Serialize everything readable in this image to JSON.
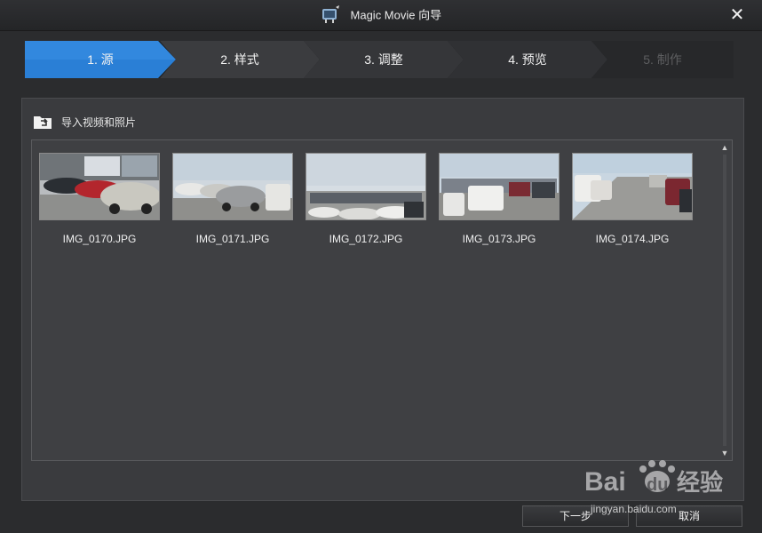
{
  "window": {
    "title": "Magic Movie 向导",
    "icons": {
      "app": "magic-movie-icon",
      "close": "close-icon"
    },
    "close_glyph": "✕"
  },
  "steps": [
    {
      "label": "1. 源",
      "state": "active"
    },
    {
      "label": "2. 样式",
      "state": "normal"
    },
    {
      "label": "3. 调整",
      "state": "normal"
    },
    {
      "label": "4. 预览",
      "state": "normal"
    },
    {
      "label": "5. 制作",
      "state": "disabled"
    }
  ],
  "source": {
    "import_label": "导入视频和照片",
    "import_icon": "folder-import-icon",
    "items": [
      {
        "filename": "IMG_0170.JPG"
      },
      {
        "filename": "IMG_0171.JPG"
      },
      {
        "filename": "IMG_0172.JPG"
      },
      {
        "filename": "IMG_0173.JPG"
      },
      {
        "filename": "IMG_0174.JPG"
      }
    ]
  },
  "footer": {
    "next_label": "下一步",
    "cancel_label": "取消"
  },
  "watermark": {
    "logo_text": "Bai du 经验",
    "url": "jingyan.baidu.com"
  },
  "colors": {
    "active_step": "#2a7fd6",
    "background": "#2b2c2e",
    "panel": "#3a3b3e"
  }
}
